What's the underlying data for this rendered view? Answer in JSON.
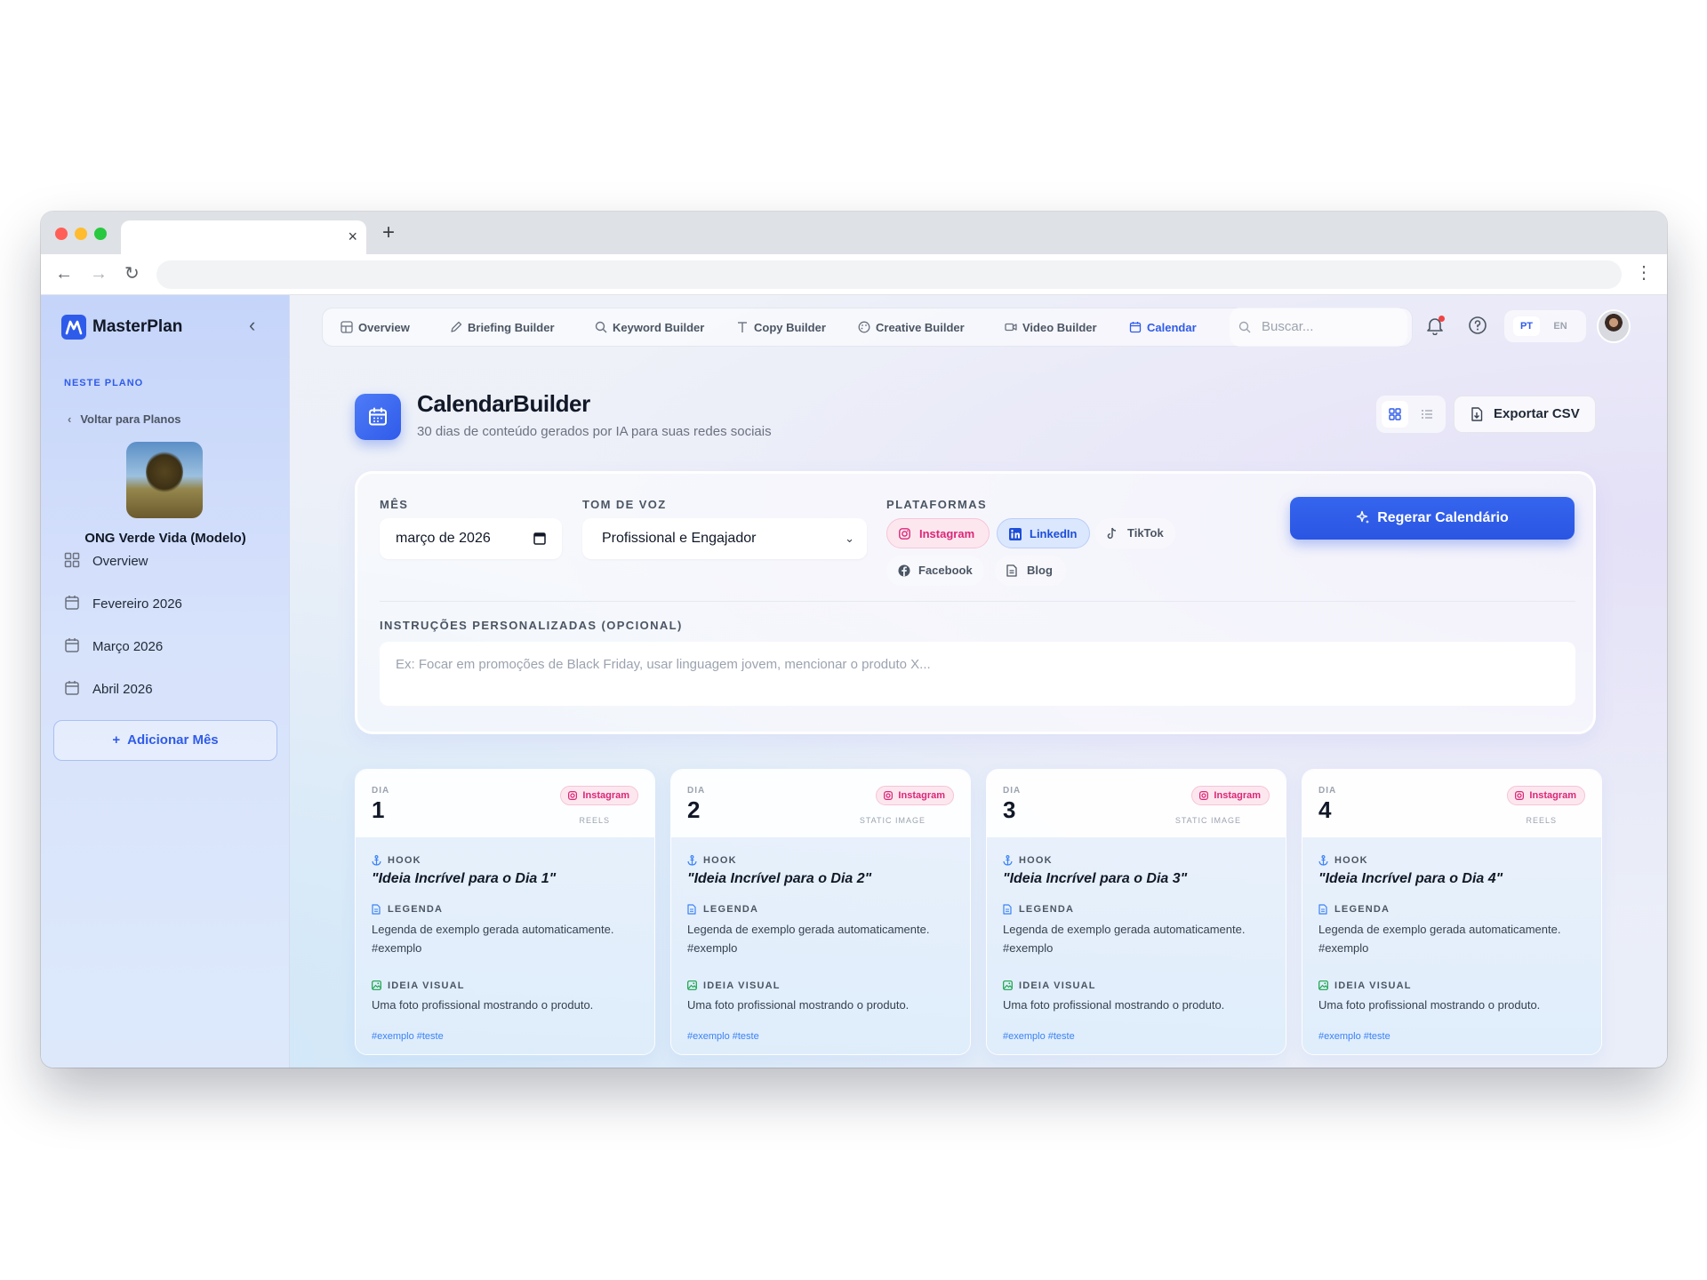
{
  "browser": {
    "tab_close": "×",
    "new_tab": "+",
    "back": "←",
    "forward": "→",
    "reload": "↻",
    "menu": "⋮"
  },
  "sidebar": {
    "brand": "MasterPlan",
    "collapse_icon": "‹",
    "section_label": "NESTE PLANO",
    "back_link": "Voltar para Planos",
    "org_name": "ONG Verde Vida (Modelo)",
    "items": [
      {
        "label": "Overview",
        "icon": "grid-icon"
      },
      {
        "label": "Fevereiro 2026",
        "icon": "calendar-icon"
      },
      {
        "label": "Março 2026",
        "icon": "calendar-icon"
      },
      {
        "label": "Abril 2026",
        "icon": "calendar-icon"
      }
    ],
    "add_month": "Adicionar Mês"
  },
  "topnav": {
    "items": [
      {
        "label": "Overview",
        "icon": "layout-icon"
      },
      {
        "label": "Briefing Builder",
        "icon": "pen-icon"
      },
      {
        "label": "Keyword Builder",
        "icon": "search-icon"
      },
      {
        "label": "Copy Builder",
        "icon": "type-icon"
      },
      {
        "label": "Creative Builder",
        "icon": "palette-icon"
      },
      {
        "label": "Video Builder",
        "icon": "video-icon"
      },
      {
        "label": "Calendar",
        "icon": "calendar-icon",
        "active": true
      }
    ],
    "search_placeholder": "Buscar...",
    "lang_active": "PT",
    "lang_other": "EN",
    "accent": "#2f5bea"
  },
  "header": {
    "title": "CalendarBuilder",
    "subtitle": "30 dias de conteúdo gerados por IA para suas redes sociais",
    "export_label": "Exportar CSV"
  },
  "form": {
    "month_label": "MÊS",
    "month_value": "março de 2026",
    "tone_label": "TOM DE VOZ",
    "tone_value": "Profissional e Engajador",
    "platforms_label": "PLATAFORMAS",
    "platforms": [
      {
        "label": "Instagram",
        "selected": true,
        "color": "#db2777"
      },
      {
        "label": "LinkedIn",
        "selected": true,
        "color": "#1d4ed8"
      },
      {
        "label": "TikTok",
        "selected": false
      },
      {
        "label": "Facebook",
        "selected": false
      },
      {
        "label": "Blog",
        "selected": false
      }
    ],
    "regenerate_label": "Regerar Calendário",
    "instructions_label": "INSTRUÇÕES PERSONALIZADAS (OPCIONAL)",
    "instructions_placeholder": "Ex: Focar em promoções de Black Friday, usar linguagem jovem, mencionar o produto X..."
  },
  "cards": [
    {
      "dia_label": "DIA",
      "day": "1",
      "platform": "Instagram",
      "format": "REELS",
      "hook_label": "HOOK",
      "hook": "\"Ideia Incrível para o Dia 1\"",
      "caption_label": "LEGENDA",
      "caption": "Legenda de exemplo gerada automaticamente. #exemplo",
      "visual_label": "IDEIA VISUAL",
      "visual": "Uma foto profissional mostrando o produto.",
      "tags": "#exemplo #teste"
    },
    {
      "dia_label": "DIA",
      "day": "2",
      "platform": "Instagram",
      "format": "STATIC IMAGE",
      "hook_label": "HOOK",
      "hook": "\"Ideia Incrível para o Dia 2\"",
      "caption_label": "LEGENDA",
      "caption": "Legenda de exemplo gerada automaticamente. #exemplo",
      "visual_label": "IDEIA VISUAL",
      "visual": "Uma foto profissional mostrando o produto.",
      "tags": "#exemplo #teste"
    },
    {
      "dia_label": "DIA",
      "day": "3",
      "platform": "Instagram",
      "format": "STATIC IMAGE",
      "hook_label": "HOOK",
      "hook": "\"Ideia Incrível para o Dia 3\"",
      "caption_label": "LEGENDA",
      "caption": "Legenda de exemplo gerada automaticamente. #exemplo",
      "visual_label": "IDEIA VISUAL",
      "visual": "Uma foto profissional mostrando o produto.",
      "tags": "#exemplo #teste"
    },
    {
      "dia_label": "DIA",
      "day": "4",
      "platform": "Instagram",
      "format": "REELS",
      "hook_label": "HOOK",
      "hook": "\"Ideia Incrível para o Dia 4\"",
      "caption_label": "LEGENDA",
      "caption": "Legenda de exemplo gerada automaticamente. #exemplo",
      "visual_label": "IDEIA VISUAL",
      "visual": "Uma foto profissional mostrando o produto.",
      "tags": "#exemplo #teste"
    }
  ]
}
